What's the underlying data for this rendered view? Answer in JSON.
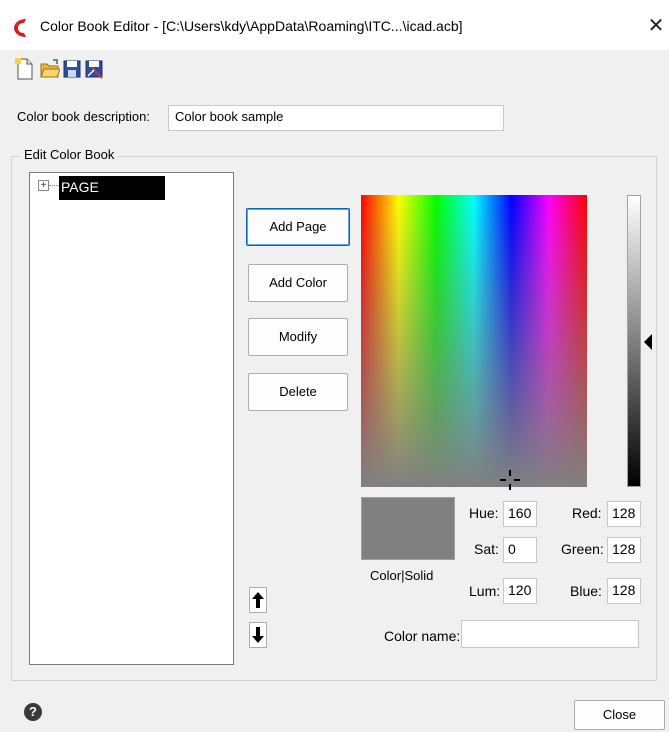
{
  "window": {
    "title": "Color Book Editor - [C:\\Users\\kdy\\AppData\\Roaming\\ITC...\\icad.acb]",
    "close_glyph": "✕"
  },
  "toolbar": {
    "icons": [
      "new-file-icon",
      "open-folder-icon",
      "save-icon",
      "save-as-icon"
    ]
  },
  "description": {
    "label": "Color book description:",
    "value": "Color book sample"
  },
  "edit_group": {
    "title": "Edit Color Book",
    "tree": {
      "expander": "+",
      "items": [
        {
          "label": "PAGE",
          "selected": true
        }
      ]
    },
    "buttons": {
      "add_page": "Add Page",
      "add_color": "Add Color",
      "modify": "Modify",
      "delete": "Delete"
    }
  },
  "color_picker": {
    "swatch_color": "#808080",
    "swatch_label": "Color|Solid",
    "hue_label": "Hue:",
    "hue_value": "160",
    "sat_label": "Sat:",
    "sat_value": "0",
    "lum_label": "Lum:",
    "lum_value": "120",
    "red_label": "Red:",
    "red_value": "128",
    "green_label": "Green:",
    "green_value": "128",
    "blue_label": "Blue:",
    "blue_value": "128",
    "color_name_label": "Color name:",
    "color_name_value": ""
  },
  "footer": {
    "help_glyph": "?",
    "close_label": "Close"
  }
}
